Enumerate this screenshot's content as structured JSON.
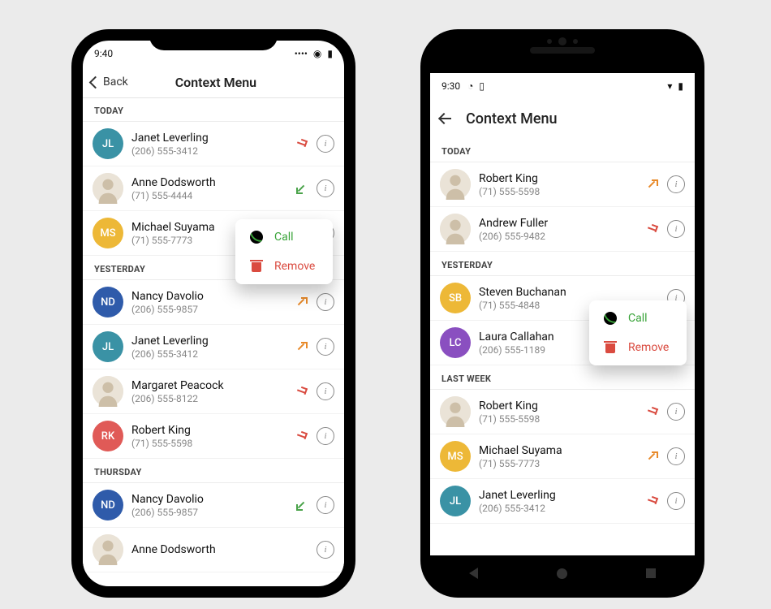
{
  "context": {
    "call": "Call",
    "remove": "Remove"
  },
  "avatar_colors": {
    "JL": "#3a92a5",
    "MS": "#edb837",
    "ND": "#2f5baa",
    "RK": "#e05a57",
    "SB": "#edb837",
    "LC": "#8a4fc0"
  },
  "ios": {
    "status": {
      "time": "9:40"
    },
    "nav": {
      "back": "Back",
      "title": "Context Menu"
    },
    "groups": [
      {
        "label": "TODAY",
        "entries": [
          {
            "name": "Janet Leverling",
            "phone": "(206) 555-3412",
            "avatar": "JL",
            "dir": "missed"
          },
          {
            "name": "Anne Dodsworth",
            "phone": "(71) 555-4444",
            "avatar": "photo",
            "dir": "incoming"
          },
          {
            "name": "Michael Suyama",
            "phone": "(71) 555-7773",
            "avatar": "MS",
            "dir": ""
          }
        ]
      },
      {
        "label": "YESTERDAY",
        "entries": [
          {
            "name": "Nancy Davolio",
            "phone": "(206) 555-9857",
            "avatar": "ND",
            "dir": "outgoing"
          },
          {
            "name": "Janet Leverling",
            "phone": "(206) 555-3412",
            "avatar": "JL",
            "dir": "outgoing"
          },
          {
            "name": "Margaret Peacock",
            "phone": "(206) 555-8122",
            "avatar": "photo",
            "dir": "missed"
          },
          {
            "name": "Robert King",
            "phone": "(71) 555-5598",
            "avatar": "RK",
            "dir": "missed"
          }
        ]
      },
      {
        "label": "THURSDAY",
        "entries": [
          {
            "name": "Nancy Davolio",
            "phone": "(206) 555-9857",
            "avatar": "ND",
            "dir": "incoming"
          },
          {
            "name": "Anne Dodsworth",
            "phone": "",
            "avatar": "photo",
            "dir": ""
          }
        ]
      }
    ]
  },
  "android": {
    "status": {
      "time": "9:30"
    },
    "nav": {
      "title": "Context Menu"
    },
    "groups": [
      {
        "label": "TODAY",
        "entries": [
          {
            "name": "Robert King",
            "phone": "(71) 555-5598",
            "avatar": "photo",
            "dir": "outgoing"
          },
          {
            "name": "Andrew Fuller",
            "phone": "(206) 555-9482",
            "avatar": "photo",
            "dir": "missed"
          }
        ]
      },
      {
        "label": "YESTERDAY",
        "entries": [
          {
            "name": "Steven Buchanan",
            "phone": "(71) 555-4848",
            "avatar": "SB",
            "dir": ""
          },
          {
            "name": "Laura Callahan",
            "phone": "(206) 555-1189",
            "avatar": "LC",
            "dir": "incoming"
          }
        ]
      },
      {
        "label": "LAST WEEK",
        "entries": [
          {
            "name": "Robert King",
            "phone": "(71) 555-5598",
            "avatar": "photo",
            "dir": "missed"
          },
          {
            "name": "Michael Suyama",
            "phone": "(71) 555-7773",
            "avatar": "MS",
            "dir": "outgoing"
          },
          {
            "name": "Janet Leverling",
            "phone": "(206) 555-3412",
            "avatar": "JL",
            "dir": "missed"
          }
        ]
      }
    ]
  }
}
